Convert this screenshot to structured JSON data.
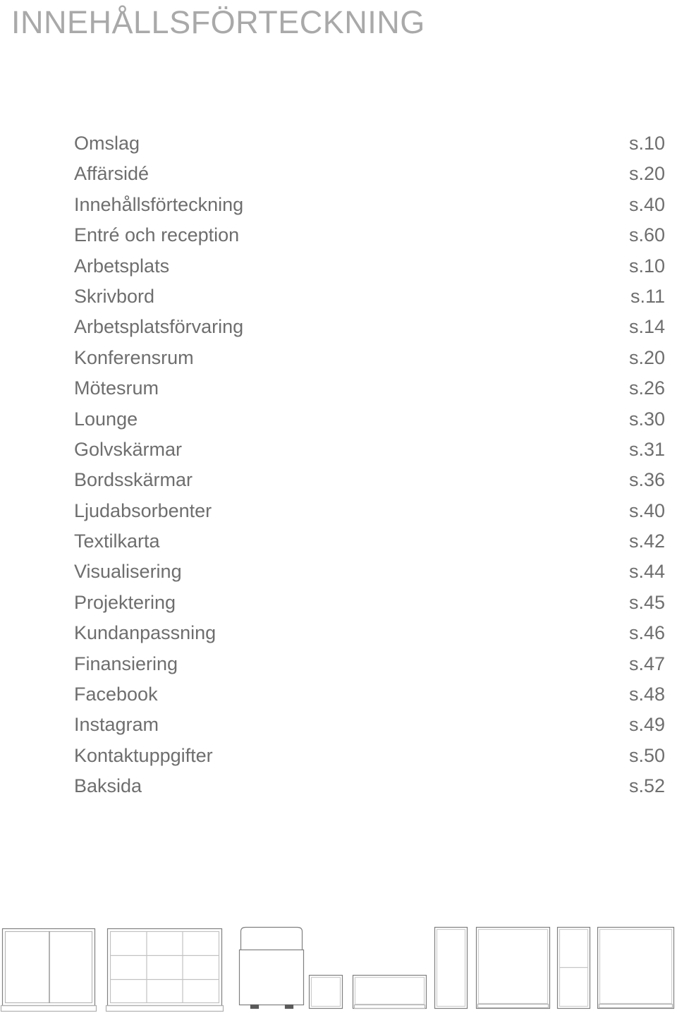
{
  "page": {
    "title": "INNEHÅLLSFÖRTECKNING",
    "text_color": "#6e6e6e",
    "title_color": "#a9a9a9",
    "background": "#ffffff",
    "line_color": "#808080"
  },
  "toc": {
    "entries": [
      {
        "label": "Omslag",
        "page": "s.10"
      },
      {
        "label": "Affärsidé",
        "page": "s.20"
      },
      {
        "label": "Innehållsförteckning",
        "page": "s.40"
      },
      {
        "label": "Entré och reception",
        "page": "s.60"
      },
      {
        "label": "Arbetsplats",
        "page": "s.10"
      },
      {
        "label": "Skrivbord",
        "page": "s.11"
      },
      {
        "label": "Arbetsplatsförvaring",
        "page": "s.14"
      },
      {
        "label": "Konferensrum",
        "page": "s.20"
      },
      {
        "label": "Mötesrum",
        "page": "s.26"
      },
      {
        "label": "Lounge",
        "page": "s.30"
      },
      {
        "label": "Golvskärmar",
        "page": "s.31"
      },
      {
        "label": "Bordsskärmar",
        "page": "s.36"
      },
      {
        "label": "Ljudabsorbenter",
        "page": "s.40"
      },
      {
        "label": "Textilkarta",
        "page": "s.42"
      },
      {
        "label": "Visualisering",
        "page": "s.44"
      },
      {
        "label": "Projektering",
        "page": "s.45"
      },
      {
        "label": "Kundanpassning",
        "page": "s.46"
      },
      {
        "label": "Finansiering",
        "page": "s.47"
      },
      {
        "label": "Facebook",
        "page": "s.48"
      },
      {
        "label": "Instagram",
        "page": "s.49"
      },
      {
        "label": "Kontaktuppgifter",
        "page": "s.50"
      },
      {
        "label": "Baksida",
        "page": "s.52"
      }
    ]
  },
  "furniture": {
    "items": [
      {
        "name": "two-door-cabinet"
      },
      {
        "name": "nine-compartment-shelf-unit"
      },
      {
        "name": "lounge-armchair"
      },
      {
        "name": "square-stool"
      },
      {
        "name": "low-bench-credenza"
      },
      {
        "name": "tall-narrow-cabinet"
      },
      {
        "name": "wide-cabinet"
      },
      {
        "name": "narrow-shelf-cabinet"
      },
      {
        "name": "wide-cabinet-right"
      }
    ]
  }
}
